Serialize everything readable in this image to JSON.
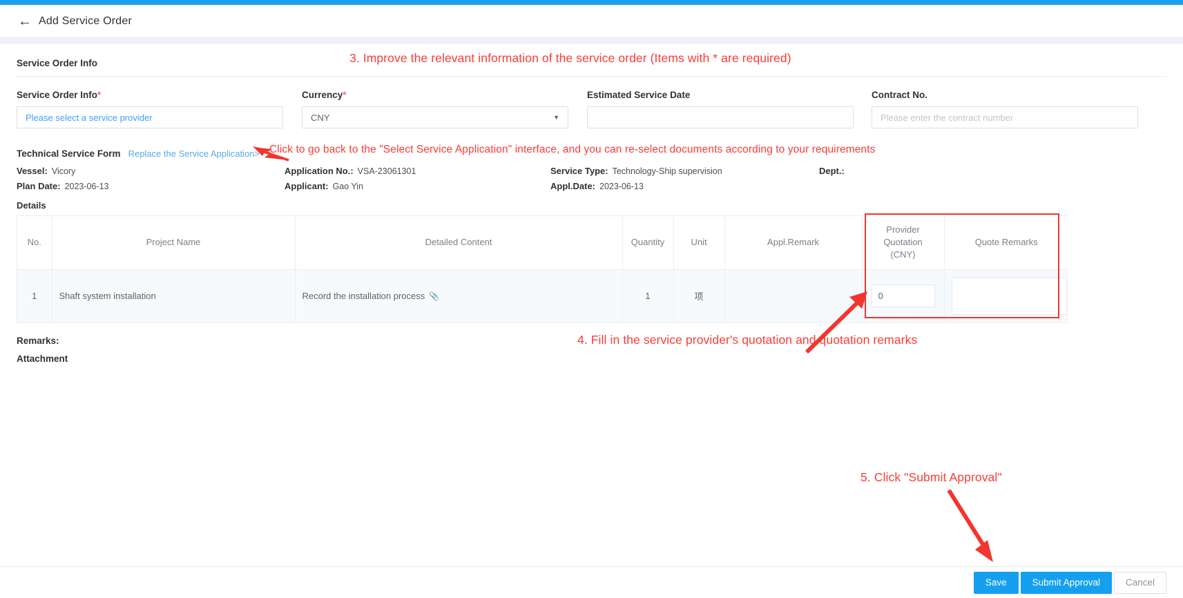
{
  "header": {
    "back_icon": "arrow-left-icon",
    "title": "Add Service Order"
  },
  "section": {
    "title": "Service Order Info"
  },
  "form": {
    "fields": [
      {
        "label": "Service Order Info",
        "required": "*",
        "value": "",
        "placeholder": "Please select a service provider",
        "type": "provider-select"
      },
      {
        "label": "Currency",
        "required": "*",
        "value": "CNY",
        "placeholder": "",
        "type": "select",
        "caret": "▼"
      },
      {
        "label": "Estimated Service Date",
        "required": "",
        "value": "",
        "placeholder": "",
        "type": "date"
      },
      {
        "label": "Contract No.",
        "required": "",
        "value": "",
        "placeholder": "Please enter the contract number",
        "type": "text"
      }
    ]
  },
  "technical_service_form": {
    "title": "Technical Service Form",
    "replace_link": "Replace the Service Application>",
    "meta": {
      "vessel_label": "Vessel:",
      "vessel_value": "Vicory",
      "plan_date_label": "Plan Date:",
      "plan_date_value": "2023-06-13",
      "application_no_label": "Application No.:",
      "application_no_value": "VSA-23061301",
      "applicant_label": "Applicant:",
      "applicant_value": "Gao Yin",
      "service_type_label": "Service Type:",
      "service_type_value": "Technology-Ship supervision",
      "appl_date_label": "Appl.Date:",
      "appl_date_value": "2023-06-13",
      "dept_label": "Dept.:",
      "dept_value": ""
    },
    "details_label": "Details"
  },
  "table": {
    "columns": [
      "No.",
      "Project Name",
      "Detailed Content",
      "Quantity",
      "Unit",
      "Appl.Remark",
      "Provider Quotation (CNY)",
      "Quote Remarks"
    ],
    "quote_header_lines": [
      "Provider",
      "Quotation",
      "(CNY)"
    ],
    "rows": [
      {
        "no": "1",
        "project_name": "Shaft system installation",
        "detailed_content": "Record the installation process",
        "attachment_icon": "paperclip-icon",
        "quantity": "1",
        "unit": "项",
        "appl_remark": "",
        "provider_quotation": "0",
        "quote_remarks": ""
      }
    ]
  },
  "remarks": {
    "label": "Remarks:",
    "value": ""
  },
  "attachment": {
    "label": "Attachment",
    "value": ""
  },
  "footer": {
    "save_label": "Save",
    "submit_label": "Submit Approval",
    "cancel_label": "Cancel"
  },
  "annotations": [
    {
      "id": "anno-3",
      "text": "3. Improve the relevant information of the service order (Items with * are required)"
    },
    {
      "id": "anno-link",
      "text": "Click to go back to the \"Select Service Application\" interface, and you can re-select documents according to your requirements"
    },
    {
      "id": "anno-4",
      "text": "4. Fill in the service provider's quotation and quotation remarks"
    },
    {
      "id": "anno-5",
      "text": "5. Click \"Submit Approval\""
    }
  ],
  "colors": {
    "accent": "#14a0ef",
    "topbar": "#1a9ff0",
    "annotation_red": "#fa3c37",
    "required_red": "#f56c6c",
    "link_blue": "#5aa9e6"
  }
}
